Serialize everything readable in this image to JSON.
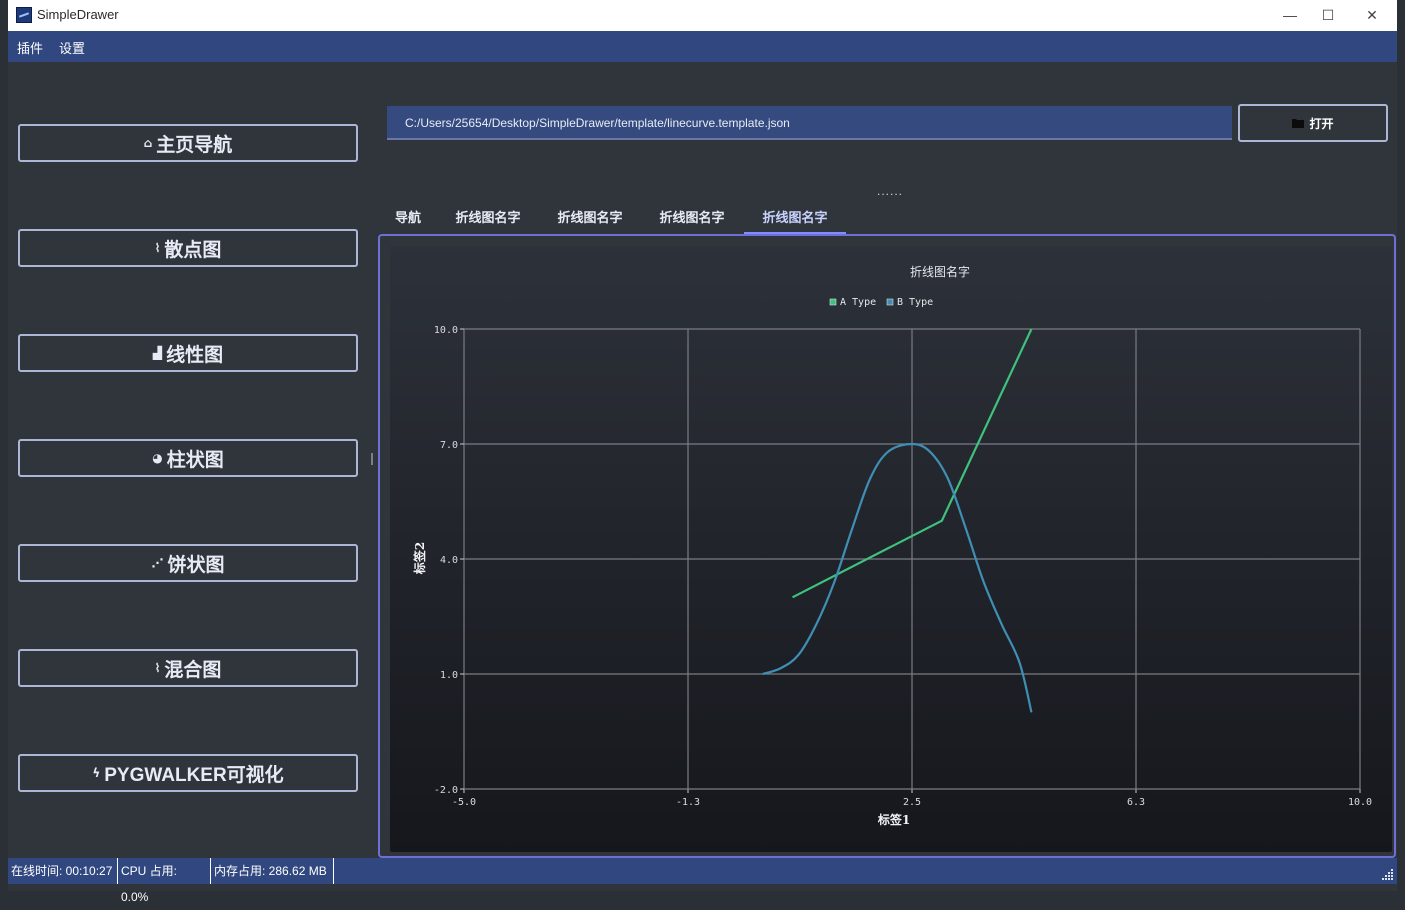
{
  "window": {
    "title": "SimpleDrawer",
    "controls": {
      "minimize": "—",
      "maximize": "☐",
      "close": "✕"
    }
  },
  "menubar": {
    "items": [
      "插件",
      "设置"
    ]
  },
  "sidebar": {
    "buttons": [
      {
        "icon": "home-icon",
        "glyph": "⌂",
        "label": "主页导航"
      },
      {
        "icon": "line-chart-icon",
        "glyph": "⌇",
        "label": "散点图"
      },
      {
        "icon": "bar-chart-icon",
        "glyph": "▟",
        "label": "线性图"
      },
      {
        "icon": "pie-chart-icon",
        "glyph": "◕",
        "label": "柱状图"
      },
      {
        "icon": "scatter-chart-icon",
        "glyph": "⋰",
        "label": "饼状图"
      },
      {
        "icon": "area-chart-icon",
        "glyph": "⌇",
        "label": "混合图"
      },
      {
        "icon": "bolt-icon",
        "glyph": "ϟ",
        "label": "PYGWALKER可视化"
      }
    ]
  },
  "toolbar": {
    "path_value": "C:/Users/25654/Desktop/SimpleDrawer/template/linecurve.template.json",
    "open_label": "打开",
    "open_icon": "folder-icon",
    "dots": "......"
  },
  "tabs": {
    "items": [
      "导航",
      "折线图名字",
      "折线图名字",
      "折线图名字",
      "折线图名字"
    ],
    "active_index": 4
  },
  "chart_data": {
    "type": "line",
    "title": "折线图名字",
    "xlabel": "标签1",
    "ylabel": "标签2",
    "xlim": [
      -5.0,
      10.0
    ],
    "ylim": [
      -2.0,
      10.0
    ],
    "xticks": [
      "-5.0",
      "-1.3",
      "2.5",
      "6.3",
      "10.0"
    ],
    "yticks": [
      "10.0",
      "7.0",
      "4.0",
      "1.0",
      "-2.0"
    ],
    "grid": true,
    "legend_position": "top-center",
    "series": [
      {
        "name": "A Type",
        "color": "#3ec27d",
        "points": [
          [
            0.5,
            3.0
          ],
          [
            3.0,
            5.0
          ],
          [
            4.5,
            10.0
          ]
        ]
      },
      {
        "name": "B Type",
        "color": "#3f8fb4",
        "points": [
          [
            0.0,
            1.0
          ],
          [
            0.3,
            1.15
          ],
          [
            0.6,
            1.5
          ],
          [
            0.9,
            2.3
          ],
          [
            1.2,
            3.4
          ],
          [
            1.5,
            4.8
          ],
          [
            1.8,
            6.1
          ],
          [
            2.1,
            6.8
          ],
          [
            2.5,
            7.0
          ],
          [
            2.8,
            6.8
          ],
          [
            3.1,
            6.1
          ],
          [
            3.4,
            4.8
          ],
          [
            3.7,
            3.4
          ],
          [
            4.0,
            2.3
          ],
          [
            4.3,
            1.3
          ],
          [
            4.5,
            0.0
          ]
        ]
      }
    ]
  },
  "statusbar": {
    "uptime": "在线时间: 00:10:27",
    "cpu": "CPU 占用: 0.0%",
    "memory": "内存占用: 286.62 MB"
  }
}
